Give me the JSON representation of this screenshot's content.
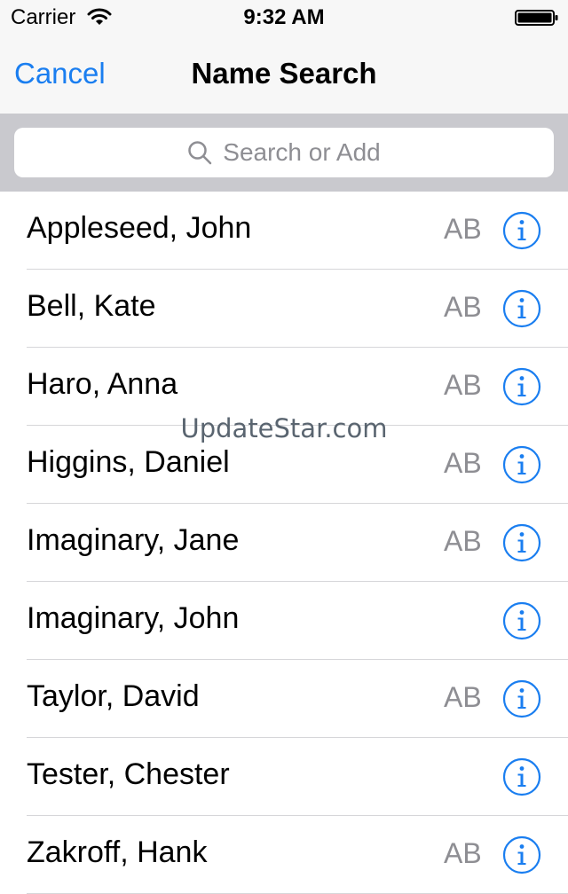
{
  "status_bar": {
    "carrier": "Carrier",
    "time": "9:32 AM",
    "icons": [
      "wifi-icon",
      "battery-icon"
    ]
  },
  "nav": {
    "cancel_label": "Cancel",
    "title": "Name Search"
  },
  "search": {
    "placeholder": "Search or Add",
    "icon": "search-icon"
  },
  "colors": {
    "accent": "#1a7ef0",
    "secondary_text": "#8e8e93",
    "search_bar_bg": "#c9c9ce"
  },
  "contacts": [
    {
      "name": "Appleseed, John",
      "badge": "AB"
    },
    {
      "name": "Bell, Kate",
      "badge": "AB"
    },
    {
      "name": "Haro, Anna",
      "badge": "AB"
    },
    {
      "name": "Higgins, Daniel",
      "badge": "AB"
    },
    {
      "name": "Imaginary, Jane",
      "badge": "AB"
    },
    {
      "name": "Imaginary, John",
      "badge": ""
    },
    {
      "name": "Taylor, David",
      "badge": "AB"
    },
    {
      "name": "Tester, Chester",
      "badge": ""
    },
    {
      "name": "Zakroff, Hank",
      "badge": "AB"
    }
  ],
  "watermark": "UpdateStar.com"
}
